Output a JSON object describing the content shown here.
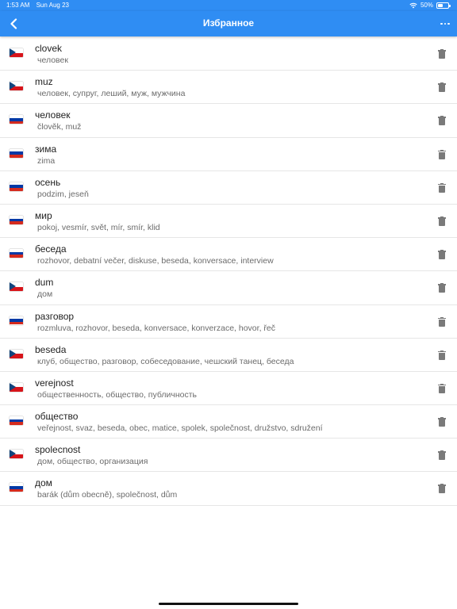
{
  "statusbar": {
    "time": "1:53 AM",
    "date": "Sun Aug 23",
    "battery": "50%",
    "battery_level": 0.5
  },
  "navbar": {
    "back_icon": "chevron-left-icon",
    "title": "Избранное",
    "more_icon": "ellipsis-icon"
  },
  "colors": {
    "accent": "#2f8df3"
  },
  "favorites": [
    {
      "flag": "cz",
      "word": "clovek",
      "translation": "человек"
    },
    {
      "flag": "cz",
      "word": "muz",
      "translation": "человек, супруг, леший, муж, мужчина"
    },
    {
      "flag": "ru",
      "word": "человек",
      "translation": "člověk, muž"
    },
    {
      "flag": "ru",
      "word": "зима",
      "translation": "zima"
    },
    {
      "flag": "ru",
      "word": "осень",
      "translation": "podzim, jeseň"
    },
    {
      "flag": "ru",
      "word": "мир",
      "translation": "pokoj, vesmír, svět, mír, smír, klid"
    },
    {
      "flag": "ru",
      "word": "беседа",
      "translation": "rozhovor, debatní večer, diskuse, beseda, konversace, interview"
    },
    {
      "flag": "cz",
      "word": "dum",
      "translation": "дом"
    },
    {
      "flag": "ru",
      "word": "разговор",
      "translation": "rozmluva, rozhovor, beseda, konversace, konverzace, hovor, řeč"
    },
    {
      "flag": "cz",
      "word": "beseda",
      "translation": "клуб, общество, разговор, собеседование, чешский танец, беседа"
    },
    {
      "flag": "cz",
      "word": "verejnost",
      "translation": "общественность, общество, публичность"
    },
    {
      "flag": "ru",
      "word": "общество",
      "translation": "veřejnost, svaz, beseda, obec, matice, spolek, společnost, družstvo, sdružení"
    },
    {
      "flag": "cz",
      "word": "spolecnost",
      "translation": "дом, общество, организация"
    },
    {
      "flag": "ru",
      "word": "дом",
      "translation": "barák (dům obecně), společnost, dům"
    }
  ]
}
